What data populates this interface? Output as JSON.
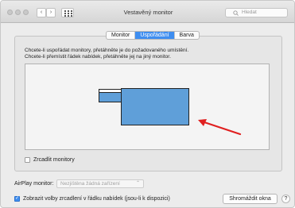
{
  "window": {
    "title": "Vestavěný monitor"
  },
  "toolbar": {
    "back": "‹",
    "forward": "›",
    "search_placeholder": "Hledat"
  },
  "tabs": [
    {
      "label": "Monitor",
      "active": false
    },
    {
      "label": "Uspořádání",
      "active": true
    },
    {
      "label": "Barva",
      "active": false
    }
  ],
  "instructions": {
    "line1": "Chcete-li uspořádat monitory, přetáhněte je do požadovaného umístění.",
    "line2": "Chcete-li přemístit řádek nabídek, přetáhněte jej na jiný monitor."
  },
  "mirror": {
    "label": "Zrcadlit monitory",
    "checked": false
  },
  "airplay": {
    "label": "AirPlay monitor:",
    "value": "Nezjištěna žádná zařízení"
  },
  "menubar_option": {
    "label": "Zobrazit volby zrcadlení v řádku nabídek (jsou-li k dispozici)",
    "checked": true
  },
  "buttons": {
    "gather": "Shromáždit okna",
    "help": "?"
  },
  "colors": {
    "accent": "#3f8ef0",
    "monitor_fill": "#5f9fd9",
    "arrow": "#e02020"
  }
}
